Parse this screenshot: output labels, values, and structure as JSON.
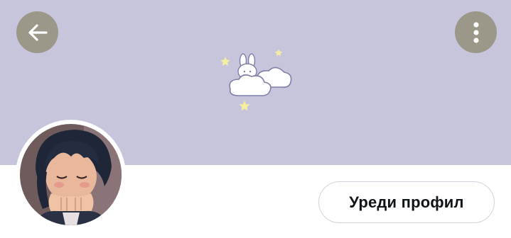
{
  "header": {
    "back_icon": "arrow-left-icon",
    "menu_icon": "more-vertical-icon",
    "banner_color": "#c7c5dc",
    "banner_art": "bunny-on-cloud-with-stars"
  },
  "profile": {
    "avatar": "user-avatar",
    "edit_profile_label": "Уреди профил"
  }
}
